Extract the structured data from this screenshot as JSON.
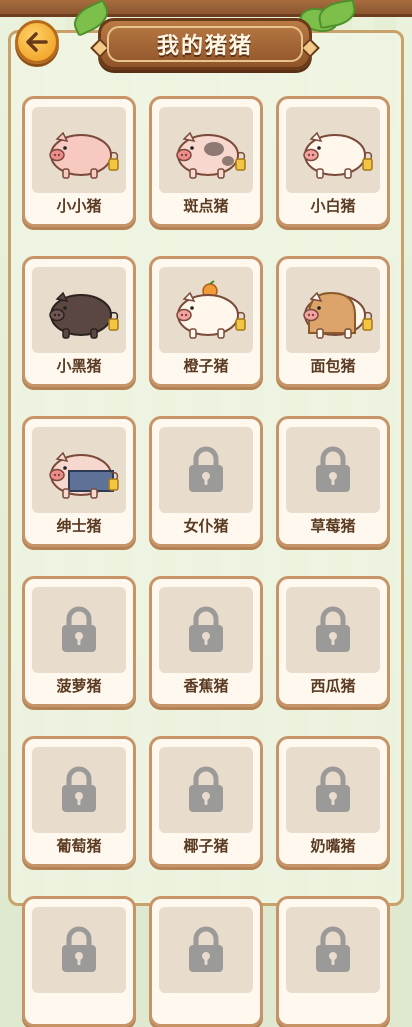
{
  "header": {
    "title": "我的猪猪"
  },
  "pigs": [
    {
      "name": "小小猪",
      "locked": false,
      "variant": "pink"
    },
    {
      "name": "斑点猪",
      "locked": false,
      "variant": "spotted"
    },
    {
      "name": "小白猪",
      "locked": false,
      "variant": "white"
    },
    {
      "name": "小黑猪",
      "locked": false,
      "variant": "black"
    },
    {
      "name": "橙子猪",
      "locked": false,
      "variant": "orange"
    },
    {
      "name": "面包猪",
      "locked": false,
      "variant": "bread"
    },
    {
      "name": "绅士猪",
      "locked": false,
      "variant": "gentleman"
    },
    {
      "name": "女仆猪",
      "locked": true
    },
    {
      "name": "草莓猪",
      "locked": true
    },
    {
      "name": "菠萝猪",
      "locked": true
    },
    {
      "name": "香蕉猪",
      "locked": true
    },
    {
      "name": "西瓜猪",
      "locked": true
    },
    {
      "name": "葡萄猪",
      "locked": true
    },
    {
      "name": "椰子猪",
      "locked": true
    },
    {
      "name": "奶嘴猪",
      "locked": true
    },
    {
      "name": "",
      "locked": true
    },
    {
      "name": "",
      "locked": true
    },
    {
      "name": "",
      "locked": true
    }
  ],
  "icons": {
    "back": "back-arrow-icon",
    "lock": "lock-icon",
    "pig": "pig-icon"
  },
  "colors": {
    "accent": "#f3a92f",
    "wood": "#8f5429",
    "card_border": "#c79468",
    "lock": "#9b9a98"
  }
}
